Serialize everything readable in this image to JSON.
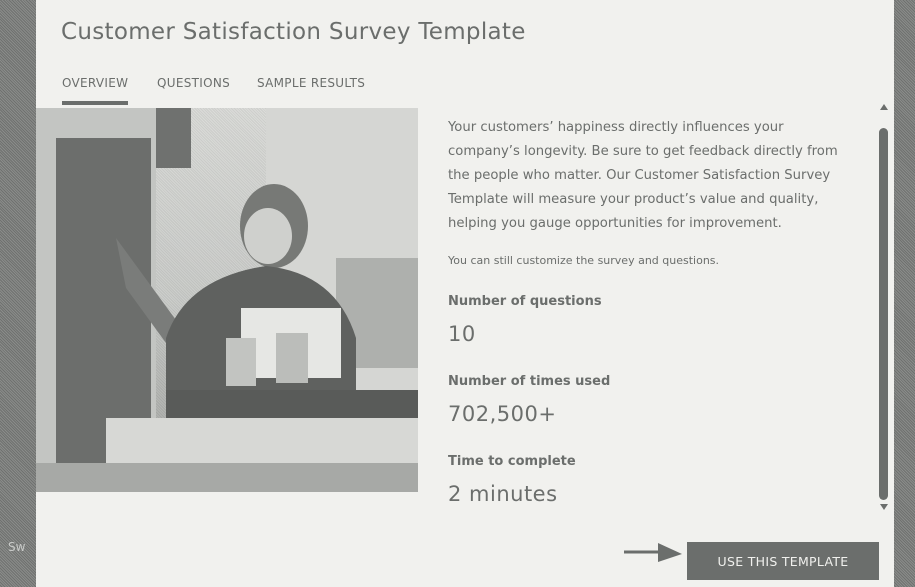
{
  "backdrop": {
    "partial_text": "Sw"
  },
  "modal": {
    "title": "Customer Satisfaction Survey Template",
    "tabs": [
      {
        "label": "OVERVIEW",
        "active": true
      },
      {
        "label": "QUESTIONS",
        "active": false
      },
      {
        "label": "SAMPLE RESULTS",
        "active": false
      }
    ],
    "description": "Your customers’ happiness directly influences your company’s longevity. Be sure to get feedback directly from the people who matter. Our Customer Satisfaction Survey Template will measure your product’s value and quality, helping you gauge opportunities for improvement.",
    "customize_note": "You can still customize the survey and questions.",
    "stats": [
      {
        "label": "Number of questions",
        "value": "10"
      },
      {
        "label": "Number of times used",
        "value": "702,500+"
      },
      {
        "label": "Time to complete",
        "value": "2 minutes"
      }
    ],
    "cta_label": "USE THIS TEMPLATE"
  },
  "icons": {
    "scroll_up": "chevron-up-icon",
    "scroll_down": "chevron-down-icon",
    "pointer": "arrow-right-icon"
  },
  "colors": {
    "modal_bg": "#f1f1ee",
    "text": "#6b6e6c",
    "button_bg": "#6b6e6c",
    "button_text": "#f1f1ee"
  }
}
